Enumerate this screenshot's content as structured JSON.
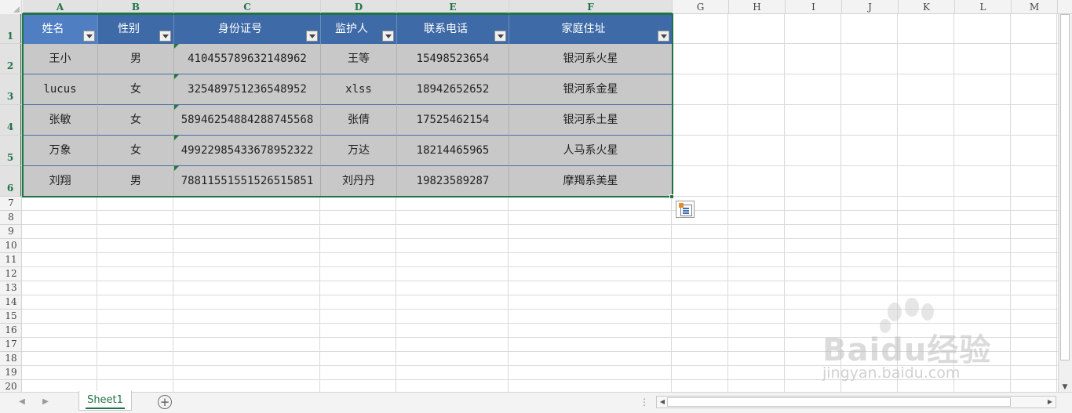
{
  "columns": [
    "A",
    "B",
    "C",
    "D",
    "E",
    "F",
    "G",
    "H",
    "I",
    "J",
    "K",
    "L",
    "M"
  ],
  "rows": [
    "1",
    "2",
    "3",
    "4",
    "5",
    "6",
    "7",
    "8",
    "9",
    "10",
    "11",
    "12",
    "13",
    "14",
    "15",
    "16",
    "17",
    "18",
    "19",
    "20"
  ],
  "table": {
    "headers": [
      "姓名",
      "性别",
      "身份证号",
      "监护人",
      "联系电话",
      "家庭住址"
    ],
    "data": [
      [
        "王小",
        "男",
        "410455789632148962",
        "王等",
        "15498523654",
        "银河系火星"
      ],
      [
        "lucus",
        "女",
        "325489751236548952",
        "xlss",
        "18942652652",
        "银河系金星"
      ],
      [
        "张敏",
        "女",
        "58946254884288745568",
        "张倩",
        "17525462154",
        "银河系土星"
      ],
      [
        "万象",
        "女",
        "49922985433678952322",
        "万达",
        "18214465965",
        "人马系火星"
      ],
      [
        "刘翔",
        "男",
        "78811551551526515851",
        "刘丹丹",
        "19823589287",
        "摩羯系美星"
      ]
    ]
  },
  "sheet_tabs": [
    "Sheet1"
  ],
  "add_sheet_label": "+",
  "status_dots": "⋮",
  "watermark": {
    "brand": "Baidu经验",
    "url": "jingyan.baidu.com"
  },
  "colors": {
    "accent": "#217346",
    "header_blue": "#3e6aa7",
    "cell_gray": "#c8c8c8"
  }
}
